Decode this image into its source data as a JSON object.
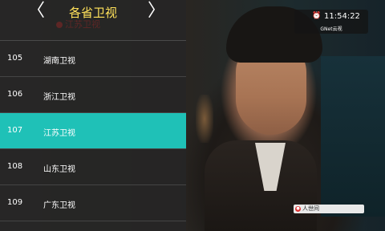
{
  "header": {
    "title": "各省卫视",
    "prev_arrow": "〈",
    "next_arrow": "〉",
    "watermark": "江苏卫视"
  },
  "channels": [
    {
      "number": "105",
      "name": "湖南卫视",
      "selected": false
    },
    {
      "number": "106",
      "name": "浙江卫视",
      "selected": false
    },
    {
      "number": "107",
      "name": "江苏卫视",
      "selected": true
    },
    {
      "number": "108",
      "name": "山东卫视",
      "selected": false
    },
    {
      "number": "109",
      "name": "广东卫视",
      "selected": false
    }
  ],
  "clock": {
    "icon": "alarm-clock-icon",
    "time": "11:54:22",
    "brand": "GNet云视"
  },
  "program_tag": {
    "icon": "channel-logo-icon",
    "text": "人世间"
  },
  "colors": {
    "accent": "#1fc1b7",
    "title": "#ffe15a",
    "panel": "#262626"
  }
}
